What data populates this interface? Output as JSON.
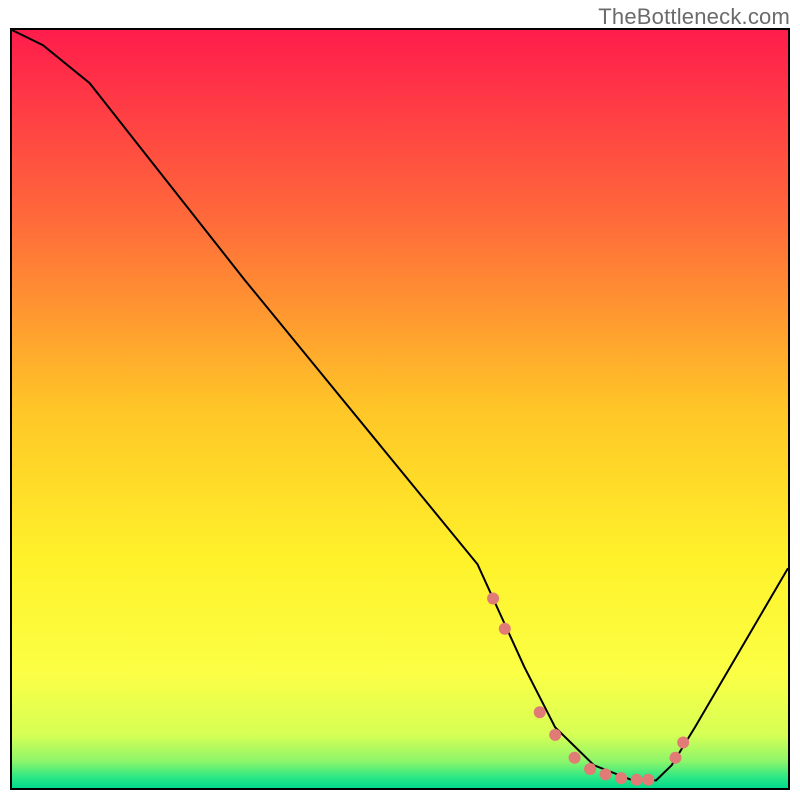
{
  "attribution": "TheBottleneck.com",
  "chart_data": {
    "type": "line",
    "title": "",
    "xlabel": "",
    "ylabel": "",
    "xlim": [
      0,
      100
    ],
    "ylim": [
      0,
      100
    ],
    "series": [
      {
        "name": "bottleneck-curve",
        "x": [
          0,
          4,
          10,
          20,
          30,
          40,
          50,
          60,
          62,
          66,
          70,
          75,
          80,
          83,
          85,
          88,
          100
        ],
        "y": [
          100,
          98,
          93,
          80,
          67,
          54.5,
          42,
          29.5,
          25,
          16,
          8,
          3,
          1,
          1,
          3,
          8,
          29
        ],
        "stroke": "#000000",
        "width": 2
      }
    ],
    "markers": {
      "name": "trough-markers",
      "color": "#e07b76",
      "radius": 6,
      "points": [
        {
          "x": 62.0,
          "y": 25.0
        },
        {
          "x": 63.5,
          "y": 21.0
        },
        {
          "x": 68.0,
          "y": 10.0
        },
        {
          "x": 70.0,
          "y": 7.0
        },
        {
          "x": 72.5,
          "y": 4.0
        },
        {
          "x": 74.5,
          "y": 2.5
        },
        {
          "x": 76.5,
          "y": 1.8
        },
        {
          "x": 78.5,
          "y": 1.3
        },
        {
          "x": 80.5,
          "y": 1.1
        },
        {
          "x": 82.0,
          "y": 1.1
        },
        {
          "x": 85.5,
          "y": 4.0
        },
        {
          "x": 86.5,
          "y": 6.0
        }
      ]
    },
    "gradient_stops": [
      {
        "offset": 0.0,
        "color": "#ff1c4c"
      },
      {
        "offset": 0.25,
        "color": "#ff6a3a"
      },
      {
        "offset": 0.5,
        "color": "#ffc627"
      },
      {
        "offset": 0.7,
        "color": "#fff22a"
      },
      {
        "offset": 0.85,
        "color": "#fbff45"
      },
      {
        "offset": 0.93,
        "color": "#d6ff55"
      },
      {
        "offset": 0.965,
        "color": "#8cf56a"
      },
      {
        "offset": 0.985,
        "color": "#2fe884"
      },
      {
        "offset": 1.0,
        "color": "#00d98c"
      }
    ]
  }
}
